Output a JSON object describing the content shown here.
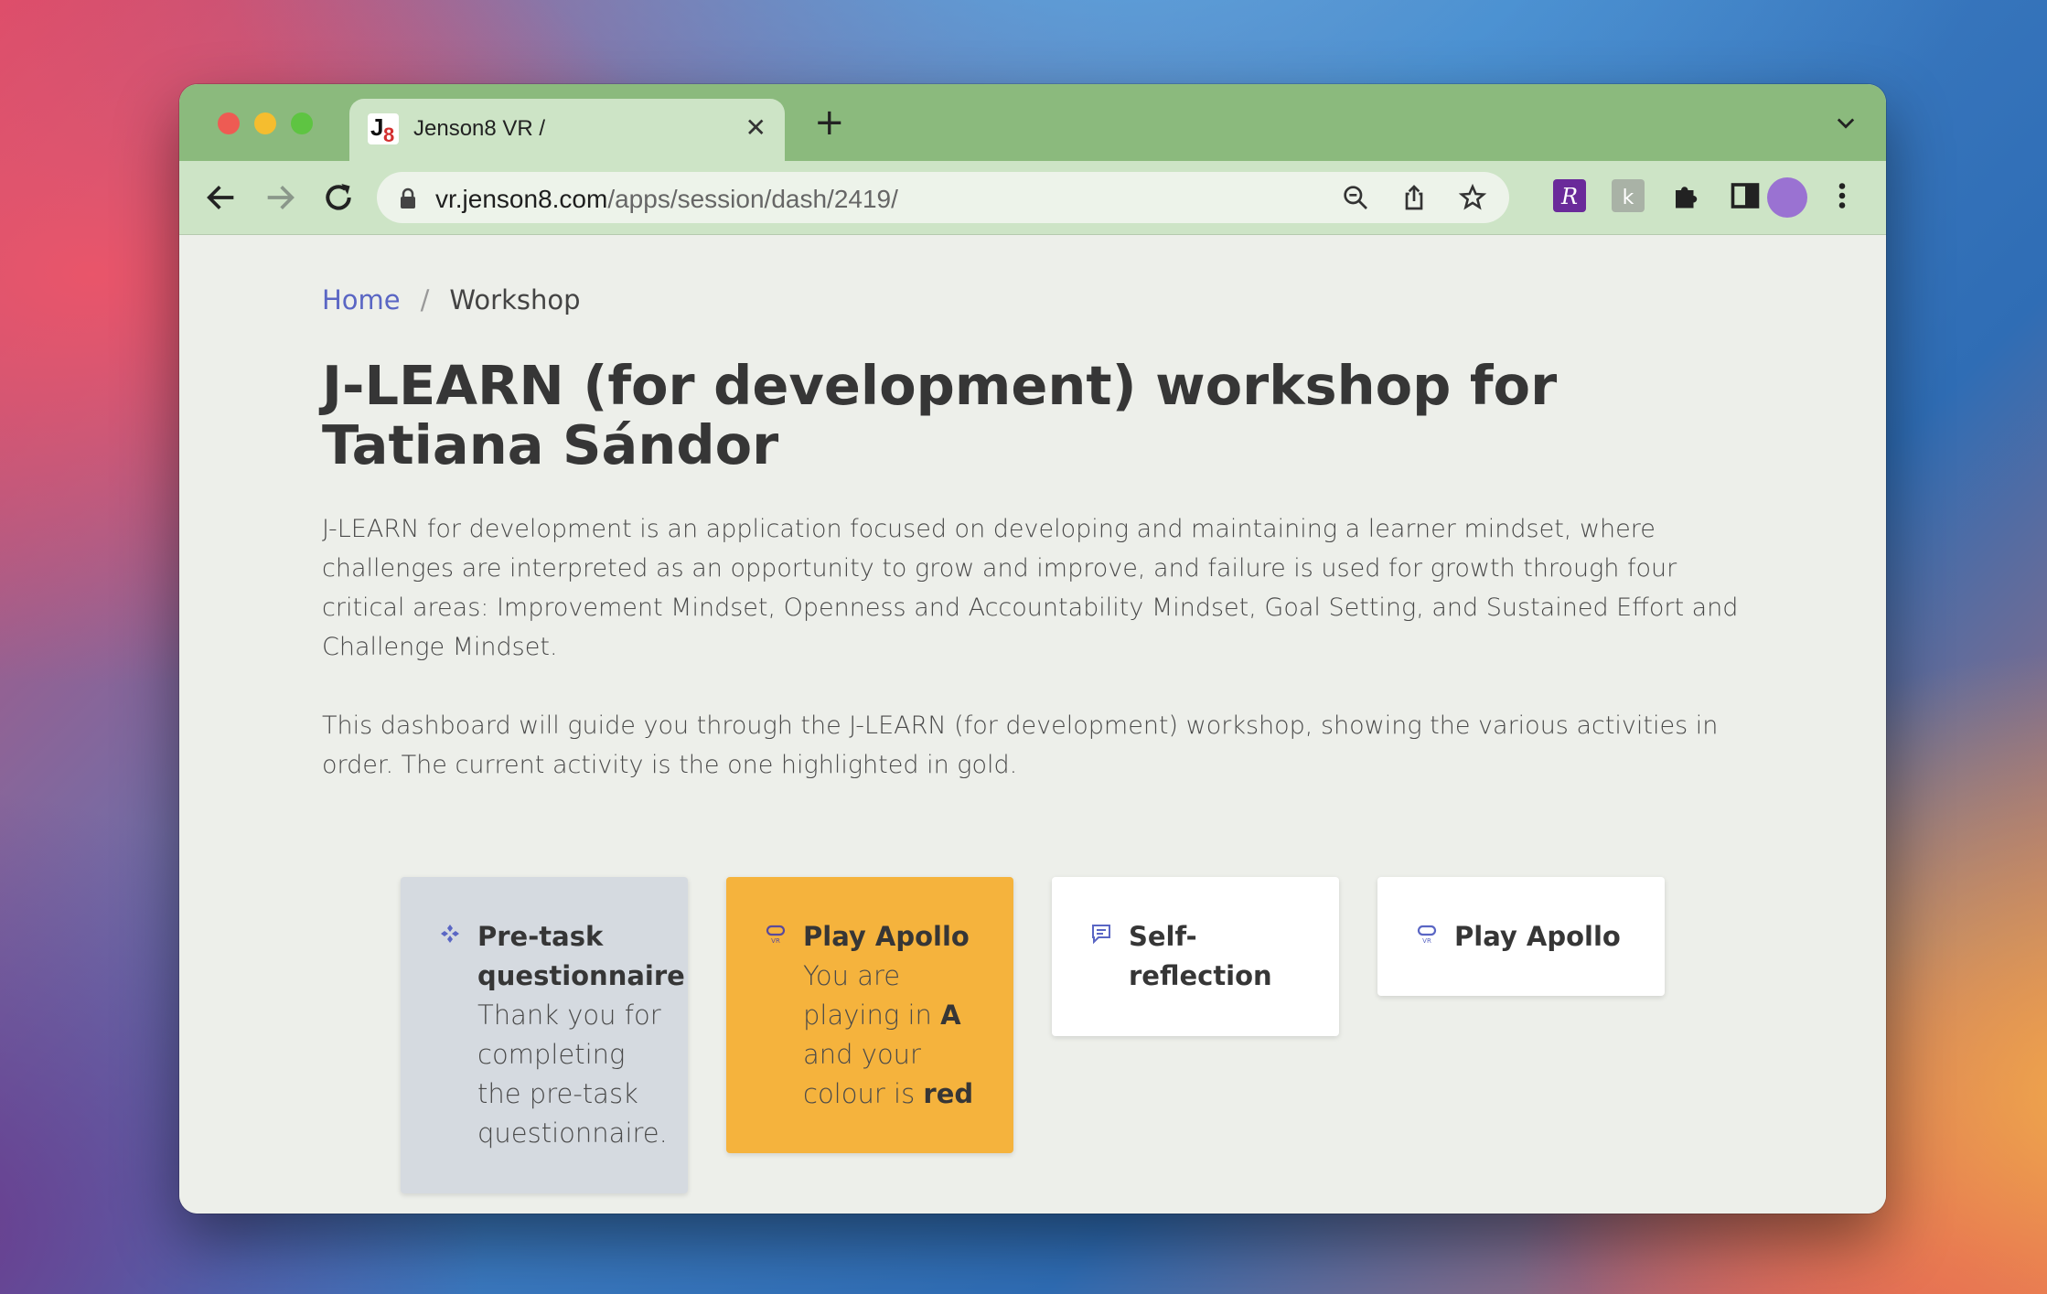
{
  "browser": {
    "tab_title": "Jenson8 VR /",
    "favicon_j": "J",
    "favicon_8": "8",
    "url_host": "vr.jenson8.com",
    "url_path": "/apps/session/dash/2419/",
    "theme_color": "#8bba7d",
    "toolbar_color": "#cde4c6",
    "extension_r_color": "#6a2a9a",
    "avatar_color": "#9a72d2"
  },
  "breadcrumb": {
    "home": "Home",
    "separator": "/",
    "current": "Workshop"
  },
  "page": {
    "title": "J-LEARN (for development) workshop for Tatiana Sándor",
    "description": "J-LEARN for development is an application focused on developing and maintaining a learner mindset, where challenges are interpreted as an opportunity to grow and improve, and failure is used for growth through four critical areas: Improvement Mindset, Openness and Accountability Mindset, Goal Setting, and Sustained Effort and Challenge Mindset.",
    "guide": "This dashboard will guide you through the J-LEARN (for development) workshop, showing the various activities in order. The current activity is the one highlighted in gold."
  },
  "activities": [
    {
      "icon": "diamond-icon",
      "title": "Pre-task questionnaire",
      "body": "Thank you for completing the pre-task questionnaire.",
      "state": "completed",
      "color": "#d5dae0"
    },
    {
      "icon": "vr-headset-icon",
      "title": "Play Apollo",
      "body_prefix": "You are playing in ",
      "location": "A",
      "body_middle": " and your colour is ",
      "colour": "red",
      "state": "current",
      "color": "#f5b33d"
    },
    {
      "icon": "comment-icon",
      "title": "Self-reflection",
      "state": "upcoming",
      "color": "#ffffff"
    },
    {
      "icon": "vr-headset-icon",
      "title": "Play Apollo",
      "state": "upcoming",
      "color": "#ffffff"
    }
  ]
}
